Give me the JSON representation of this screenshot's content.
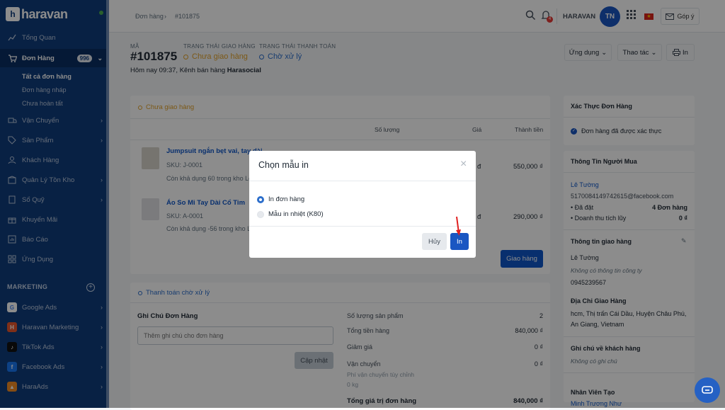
{
  "sidebar": {
    "logo": "haravan",
    "items": [
      {
        "label": "Tổng Quan",
        "icon": "chart-icon"
      },
      {
        "label": "Đơn Hàng",
        "icon": "cart-icon",
        "badge": "996"
      },
      {
        "label": "Vận Chuyển",
        "icon": "truck-icon"
      },
      {
        "label": "Sản Phẩm",
        "icon": "tag-icon"
      },
      {
        "label": "Khách Hàng",
        "icon": "user-icon"
      },
      {
        "label": "Quản Lý Tồn Kho",
        "icon": "box-icon"
      },
      {
        "label": "Sổ Quỹ",
        "icon": "book-icon"
      },
      {
        "label": "Khuyến Mãi",
        "icon": "gift-icon"
      },
      {
        "label": "Báo Cáo",
        "icon": "report-icon"
      },
      {
        "label": "Ứng Dụng",
        "icon": "apps-icon"
      }
    ],
    "sub_items": [
      "Tất cả đơn hàng",
      "Đơn hàng nháp",
      "Chưa hoàn tất"
    ],
    "marketing_title": "MARKETING",
    "marketing": [
      {
        "label": "Google Ads",
        "color": "#4285f4",
        "glyph": "G"
      },
      {
        "label": "Haravan Marketing",
        "color": "#e8572d",
        "glyph": "H"
      },
      {
        "label": "TikTok Ads",
        "color": "#111111",
        "glyph": "♪"
      },
      {
        "label": "Facebook Ads",
        "color": "#1877f2",
        "glyph": "f"
      },
      {
        "label": "HaraAds",
        "color": "#f08a24",
        "glyph": "▲"
      }
    ]
  },
  "topbar": {
    "breadcrumb": [
      "Đơn hàng",
      "#101875"
    ],
    "notif_count": "4",
    "store": "HARAVAN",
    "avatar": "TN",
    "feedback": "Góp ý"
  },
  "order": {
    "code_label": "MÃ",
    "code": "#101875",
    "ship_status_label": "TRẠNG THÁI GIAO HÀNG",
    "ship_status": "Chưa giao hàng",
    "pay_status_label": "TRẠNG THÁI THANH TOÁN",
    "pay_status": "Chờ xử lý",
    "meta": "Hôm nay 09:37, Kênh bán hàng ",
    "channel": "Harasocial",
    "btn_apps": "Ứng dụng",
    "btn_actions": "Thao tác",
    "btn_print": "In"
  },
  "fulfill": {
    "status": "Chưa giao hàng",
    "col_qty": "Số lượng",
    "col_price": "Giá",
    "col_total": "Thành tiền",
    "items": [
      {
        "name": "Jumpsuit ngắn bẹt vai, tay dài",
        "sku": "SKU: J-0001",
        "stock": "Còn khả dụng 60 trong kho Lê",
        "price": "đ",
        "total": "550,000 ₫"
      },
      {
        "name": "Áo So Mi Tay Dài Cổ Tim",
        "sku": "SKU: A-0001",
        "stock": "Còn khả dụng -56 trong kho Lê",
        "price": "đ",
        "total": "290,000 ₫"
      }
    ],
    "ship_button": "Giao hàng"
  },
  "payment": {
    "status": "Thanh toán chờ xử lý",
    "note_title": "Ghi Chú Đơn Hàng",
    "note_placeholder": "Thêm ghi chú cho đơn hàng",
    "update_button": "Cập nhật",
    "rows": [
      {
        "label": "Số lượng sản phẩm",
        "value": "2"
      },
      {
        "label": "Tổng tiền hàng",
        "value": "840,000 ₫"
      },
      {
        "label": "Giảm giá",
        "value": "0 ₫"
      },
      {
        "label": "Vận chuyển",
        "value": "0 ₫"
      }
    ],
    "shipping_sub1": "Phí vận chuyển tùy chỉnh",
    "shipping_sub2": "0 kg",
    "grand_label": "Tổng giá trị đơn hàng",
    "grand_value": "840,000 ₫"
  },
  "right": {
    "verify_title": "Xác Thực Đơn Hàng",
    "verify_text": "Đơn hàng đã được xác thực",
    "buyer_title": "Thông Tin Người Mua",
    "buyer_name": "Lê Tường",
    "buyer_email": "5170084149742615@facebook.com",
    "orders_label": "• Đã đặt",
    "orders_value": "4 Đơn hàng",
    "revenue_label": "• Doanh thu tích lũy",
    "revenue_value": "0 ₫",
    "ship_info_title": "Thông tin giao hàng",
    "ship_name": "Lê Tường",
    "ship_company": "Không có thông tin công ty",
    "ship_phone": "0945239567",
    "addr_title": "Địa Chỉ Giao Hàng",
    "addr_line1": "hcm, Thị trấn Cái Dầu, Huyện Châu Phú,",
    "addr_line2": "An Giang, Vietnam",
    "cust_note_title": "Ghi chú về khách hàng",
    "cust_note": "Không có ghi chú",
    "staff_title": "Nhân Viên Tạo",
    "staff_name": "Minh Trương Như"
  },
  "modal": {
    "title": "Chọn mẫu in",
    "options": [
      "In đơn hàng",
      "Mẫu in nhiệt (K80)"
    ],
    "cancel": "Hủy",
    "print": "In"
  }
}
